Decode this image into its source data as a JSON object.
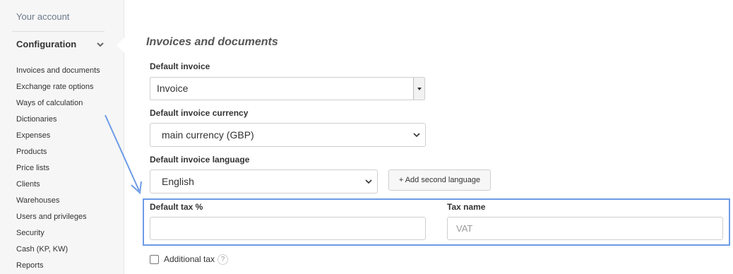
{
  "sidebar": {
    "account": "Your account",
    "section": "Configuration",
    "items": [
      "Invoices and documents",
      "Exchange rate options",
      "Ways of calculation",
      "Dictionaries",
      "Expenses",
      "Products",
      "Price lists",
      "Clients",
      "Warehouses",
      "Users and privileges",
      "Security",
      "Cash (KP, KW)",
      "Reports"
    ]
  },
  "main": {
    "title": "Invoices and documents",
    "default_invoice": {
      "label": "Default invoice",
      "value": "Invoice"
    },
    "currency": {
      "label": "Default invoice currency",
      "value": "main currency (GBP)"
    },
    "language": {
      "label": "Default invoice language",
      "value": "English",
      "add_button": "+ Add second language"
    },
    "tax": {
      "label": "Default tax %",
      "value": ""
    },
    "tax_name": {
      "label": "Tax name",
      "placeholder": "VAT"
    },
    "additional_tax": {
      "label": "Additional tax",
      "help": "?"
    }
  },
  "colors": {
    "highlight": "#6d9be6",
    "sidebar_bg": "#f6f6f6"
  }
}
